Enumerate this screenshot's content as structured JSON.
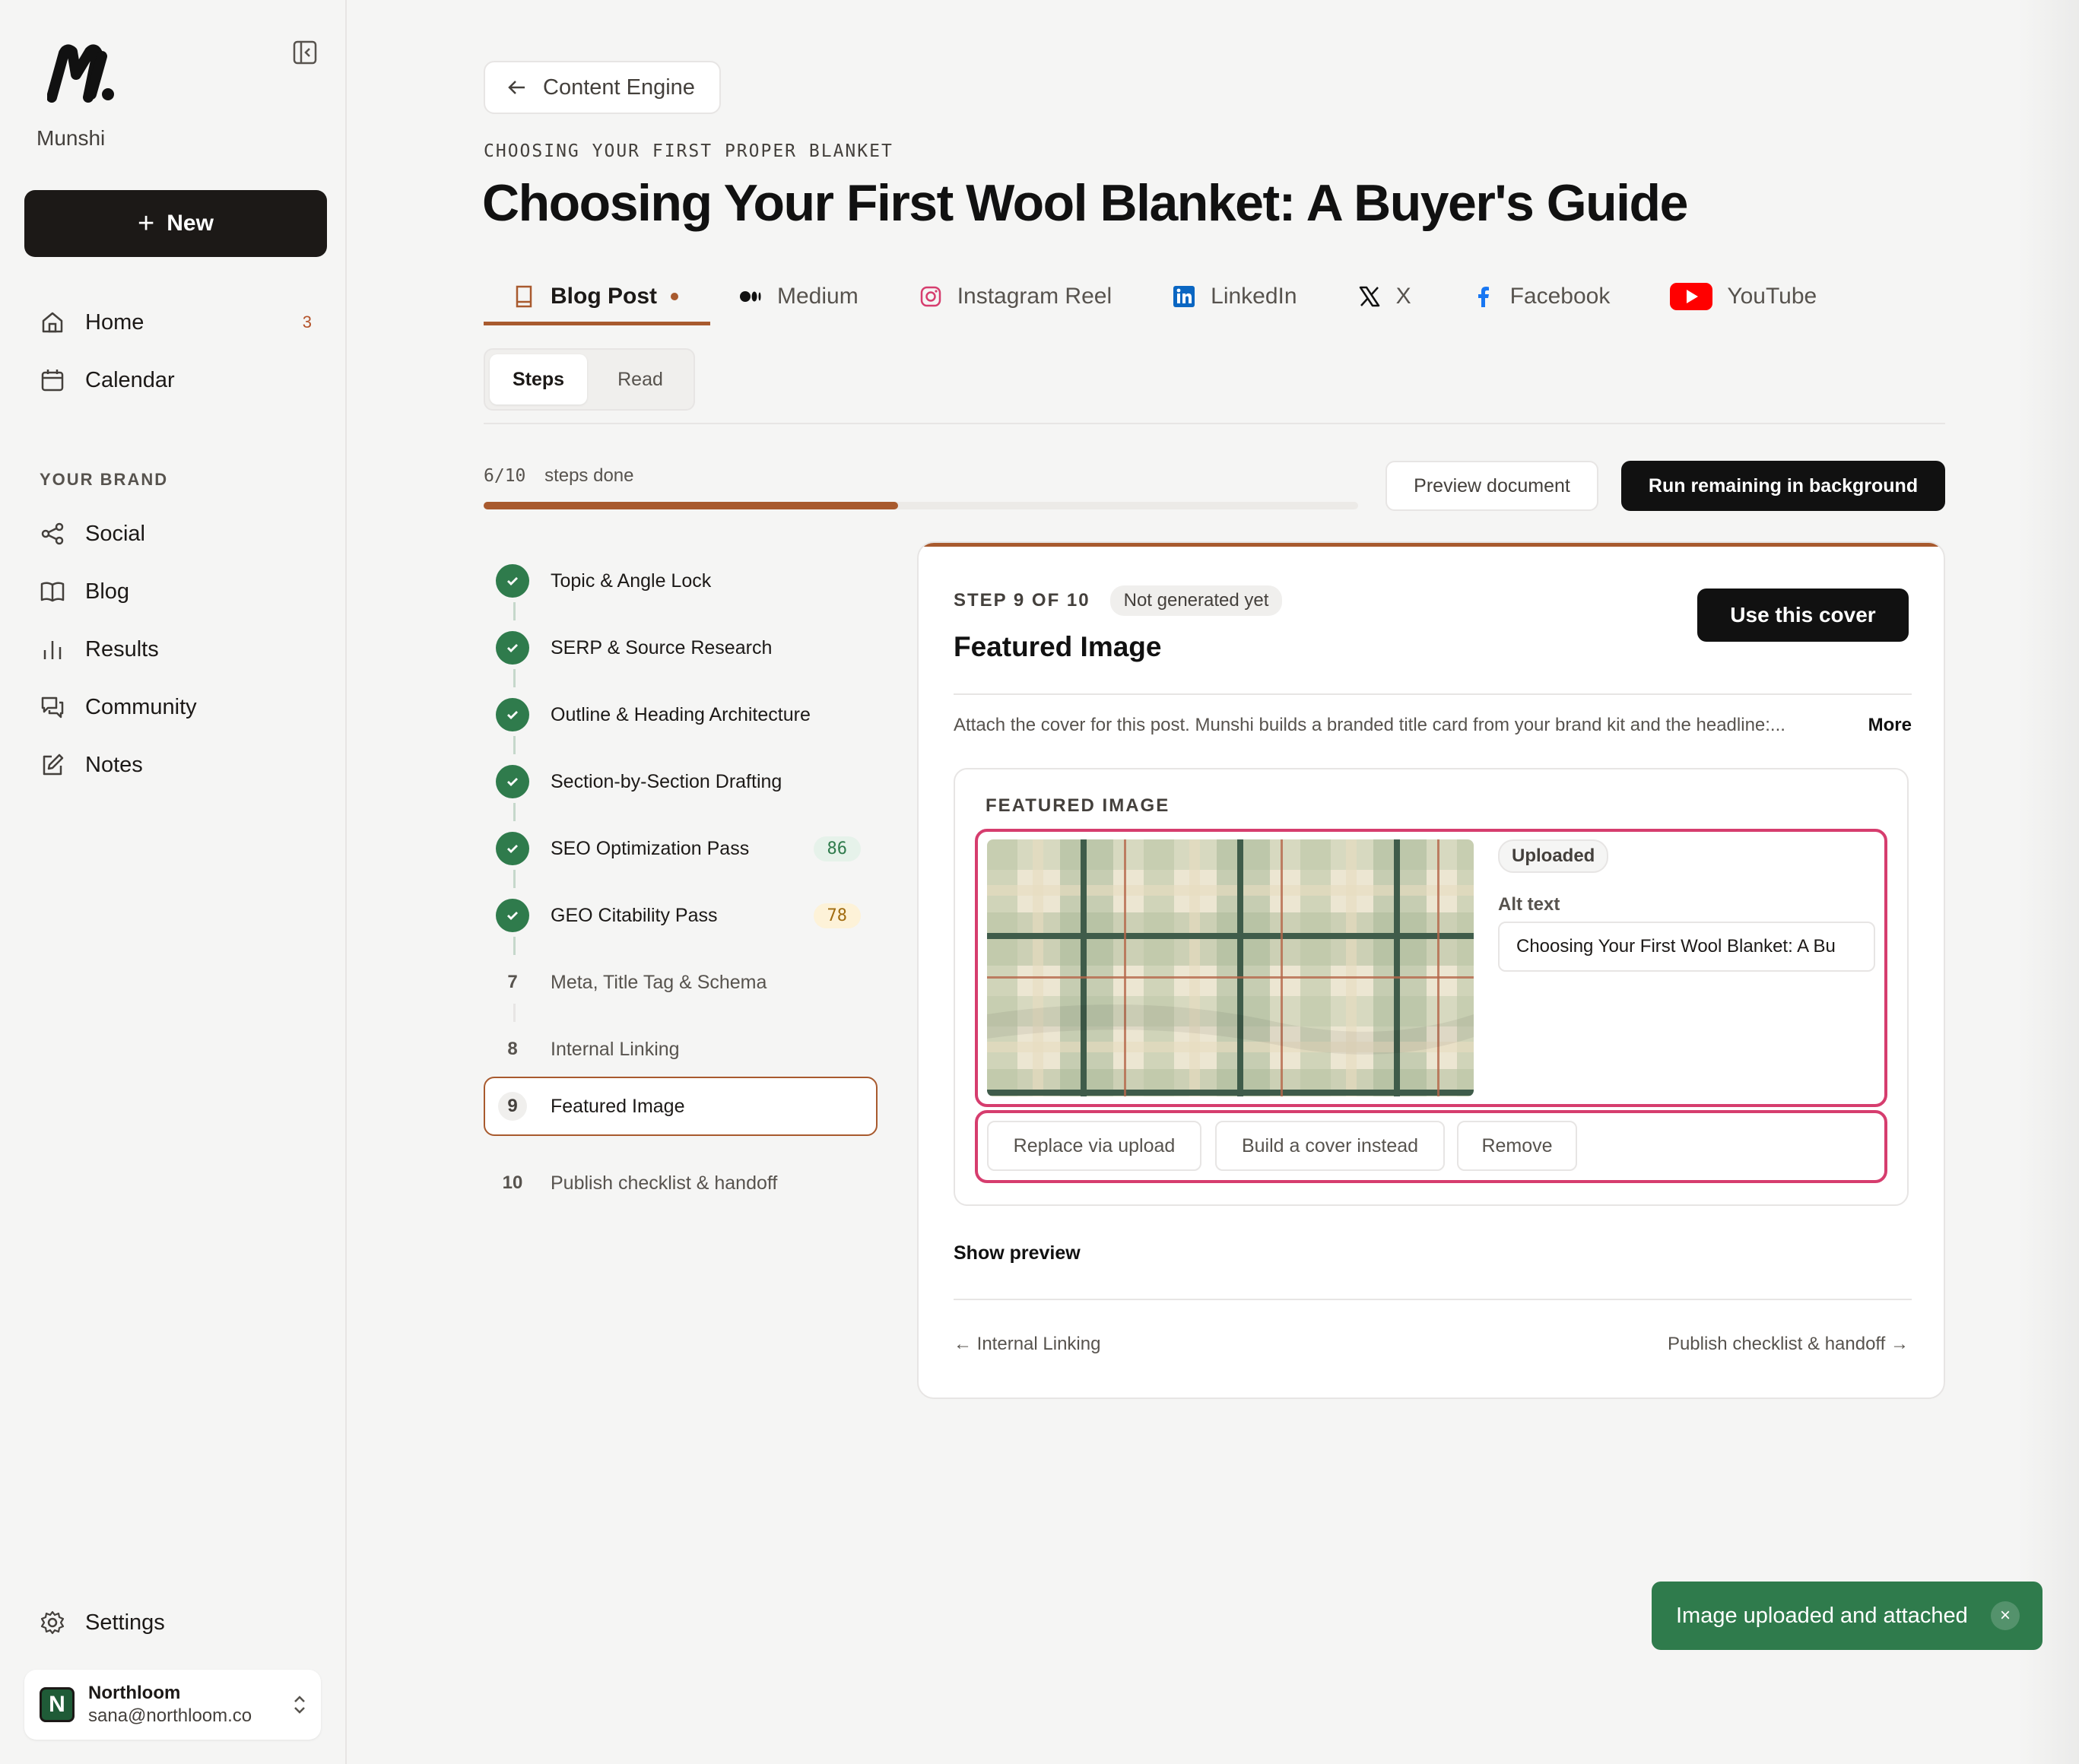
{
  "sidebar": {
    "brand_name": "Munshi",
    "new_label": "New",
    "items": [
      {
        "label": "Home",
        "icon": "home-icon",
        "badge": "3"
      },
      {
        "label": "Calendar",
        "icon": "calendar-icon"
      }
    ],
    "section_label": "YOUR BRAND",
    "brand_items": [
      {
        "label": "Social",
        "icon": "share-icon"
      },
      {
        "label": "Blog",
        "icon": "book-icon"
      },
      {
        "label": "Results",
        "icon": "bar-chart-icon"
      },
      {
        "label": "Community",
        "icon": "chat-icon"
      },
      {
        "label": "Notes",
        "icon": "edit-icon"
      }
    ],
    "settings_label": "Settings",
    "account": {
      "initial": "N",
      "name": "Northloom",
      "email": "sana@northloom.co"
    }
  },
  "header": {
    "back_label": "Content Engine",
    "eyebrow": "CHOOSING YOUR FIRST PROPER BLANKET",
    "title": "Choosing Your First Wool Blanket: A Buyer's Guide"
  },
  "tabs": [
    {
      "label": "Blog Post",
      "icon": "document-icon",
      "active": true
    },
    {
      "label": "Medium",
      "icon": "medium-icon"
    },
    {
      "label": "Instagram Reel",
      "icon": "instagram-icon"
    },
    {
      "label": "LinkedIn",
      "icon": "linkedin-icon"
    },
    {
      "label": "X",
      "icon": "x-icon"
    },
    {
      "label": "Facebook",
      "icon": "facebook-icon"
    },
    {
      "label": "YouTube",
      "icon": "youtube-icon"
    }
  ],
  "view_toggle": {
    "steps": "Steps",
    "read": "Read"
  },
  "progress": {
    "count": "6/10",
    "label": "steps done",
    "value": 0.6
  },
  "actions": {
    "preview": "Preview document",
    "run": "Run remaining in background"
  },
  "steps": [
    {
      "num": "1",
      "label": "Topic & Angle Lock",
      "done": true
    },
    {
      "num": "2",
      "label": "SERP & Source Research",
      "done": true
    },
    {
      "num": "3",
      "label": "Outline & Heading Architecture",
      "done": true
    },
    {
      "num": "4",
      "label": "Section-by-Section Drafting",
      "done": true
    },
    {
      "num": "5",
      "label": "SEO Optimization Pass",
      "done": true,
      "score": "86"
    },
    {
      "num": "6",
      "label": "GEO Citability Pass",
      "done": true,
      "score": "78"
    },
    {
      "num": "7",
      "label": "Meta, Title Tag & Schema",
      "done": false
    },
    {
      "num": "8",
      "label": "Internal Linking",
      "done": false
    },
    {
      "num": "9",
      "label": "Featured Image",
      "done": false,
      "current": true
    },
    {
      "num": "10",
      "label": "Publish checklist & handoff",
      "done": false
    }
  ],
  "card": {
    "step_count": "STEP 9 OF 10",
    "status": "Not generated yet",
    "title": "Featured Image",
    "use_cover": "Use this cover",
    "description": "Attach the cover for this post. Munshi builds a branded title card from your brand kit and the headline:...",
    "more": "More",
    "inner_label": "FEATURED IMAGE",
    "uploaded": "Uploaded",
    "alt_label": "Alt text",
    "alt_value": "Choosing Your First Wool Blanket: A Bu",
    "replace": "Replace via upload",
    "build": "Build a cover instead",
    "remove": "Remove",
    "show_preview": "Show preview",
    "prev": "← Internal Linking",
    "next": "Publish checklist & handoff →"
  },
  "toast": {
    "message": "Image uploaded and attached",
    "close": "×"
  },
  "colors": {
    "accent": "#a85a2e",
    "success": "#2f7b4c",
    "highlight": "#d63d6e",
    "dark": "#111111"
  }
}
